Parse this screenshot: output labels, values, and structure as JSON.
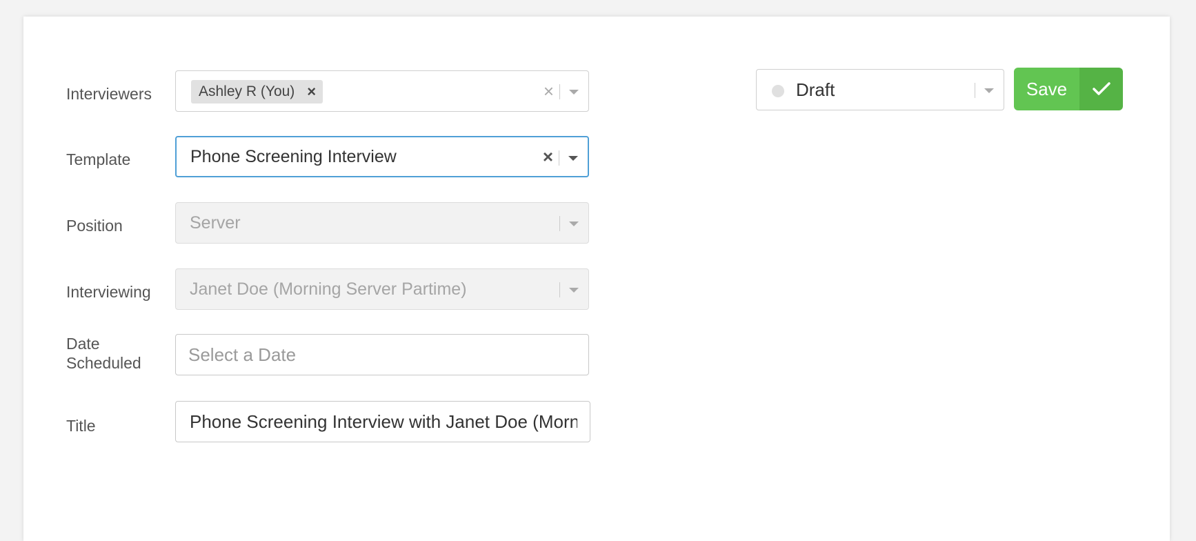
{
  "form": {
    "interviewers": {
      "label": "Interviewers",
      "tags": [
        {
          "text": "Ashley R (You)",
          "remove": "×"
        }
      ],
      "clear": "×"
    },
    "template": {
      "label": "Template",
      "value": "Phone Screening Interview",
      "clear": "×"
    },
    "position": {
      "label": "Position",
      "value": "Server"
    },
    "interviewing": {
      "label": "Interviewing",
      "value": "Janet Doe (Morning Server Partime)"
    },
    "date_scheduled": {
      "label_line1": "Date",
      "label_line2": "Scheduled",
      "placeholder": "Select a Date"
    },
    "title": {
      "label": "Title",
      "value": "Phone Screening Interview with Janet Doe (Morning Server Partime)"
    }
  },
  "status": {
    "value": "Draft"
  },
  "save": {
    "label": "Save"
  },
  "colors": {
    "save_green": "#62c552",
    "save_green_dark": "#55b345",
    "focus_blue": "#4f9fd6"
  },
  "icons": {
    "remove_tag": "close-icon",
    "clear": "close-icon",
    "dropdown": "chevron-down-icon",
    "save": "checkmark-icon",
    "status": "status-dot-icon"
  }
}
